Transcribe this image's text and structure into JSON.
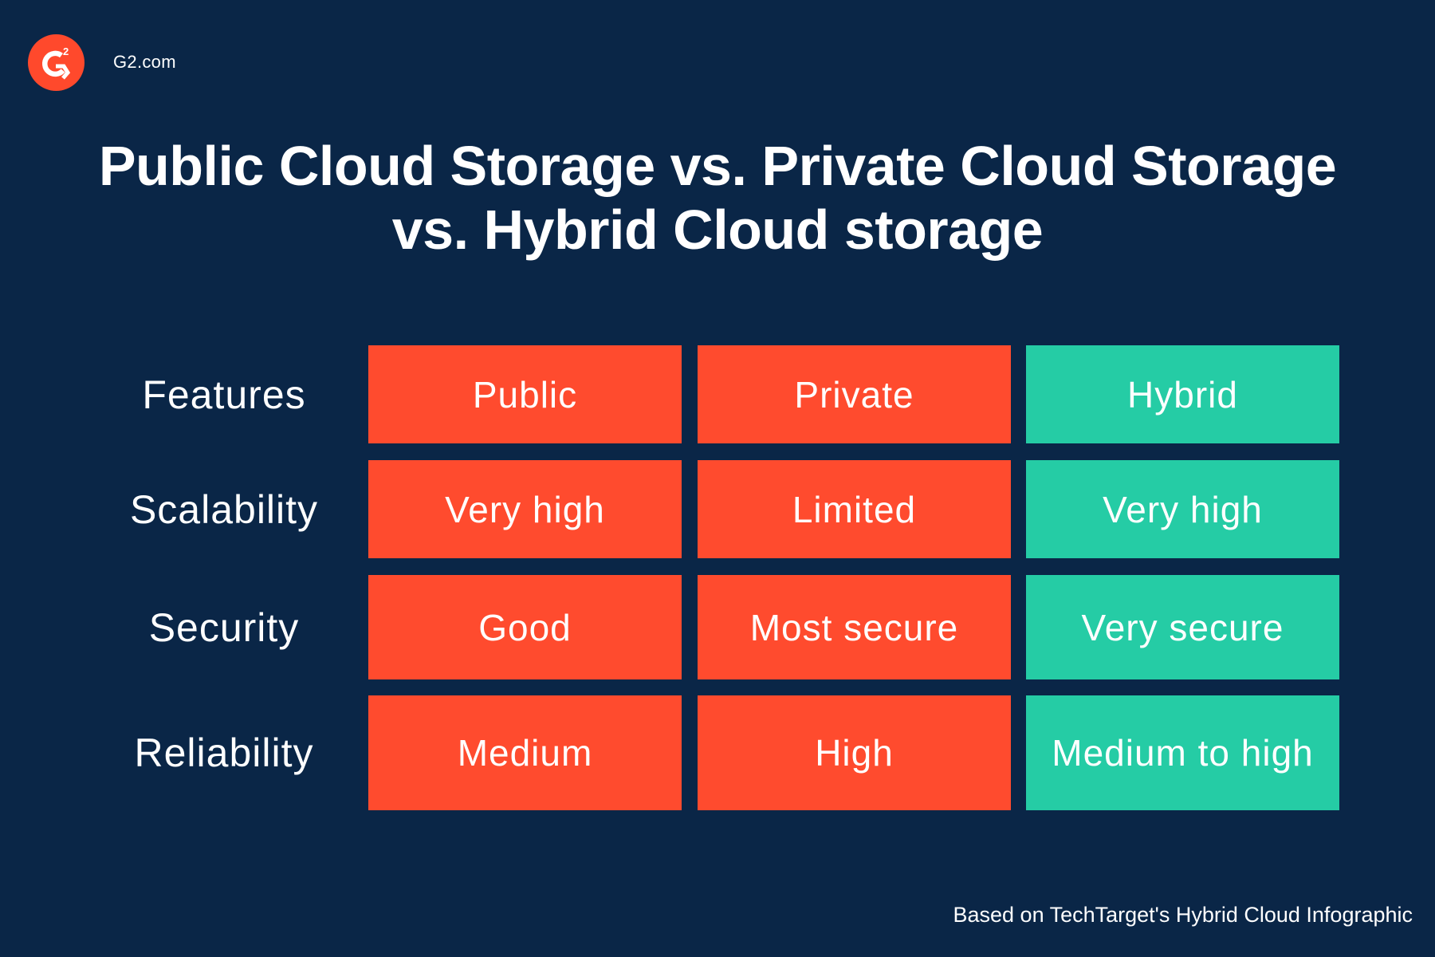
{
  "brand": {
    "logo_icon": "g2-logo-icon",
    "site_name": "G2.com",
    "colors": {
      "background": "#0a2647",
      "accent_orange": "#ff4b2e",
      "accent_teal": "#25cca5",
      "logo": "#ff492c",
      "text": "#ffffff"
    }
  },
  "title": {
    "line1": "Public Cloud Storage vs. Private Cloud Storage",
    "line2": "vs. Hybrid Cloud storage"
  },
  "table": {
    "columns": [
      {
        "label": "Features"
      },
      {
        "label": "Public",
        "color": "orange"
      },
      {
        "label": "Private",
        "color": "orange"
      },
      {
        "label": "Hybrid",
        "color": "teal"
      }
    ],
    "rows": [
      {
        "label": "Scalability",
        "public": "Very high",
        "private": "Limited",
        "hybrid": "Very high"
      },
      {
        "label": "Security",
        "public": "Good",
        "private": "Most secure",
        "hybrid": "Very secure"
      },
      {
        "label": "Reliability",
        "public": "Medium",
        "private": "High",
        "hybrid": "Medium to high"
      }
    ]
  },
  "footer": {
    "source": "Based on TechTarget's Hybrid Cloud Infographic"
  }
}
